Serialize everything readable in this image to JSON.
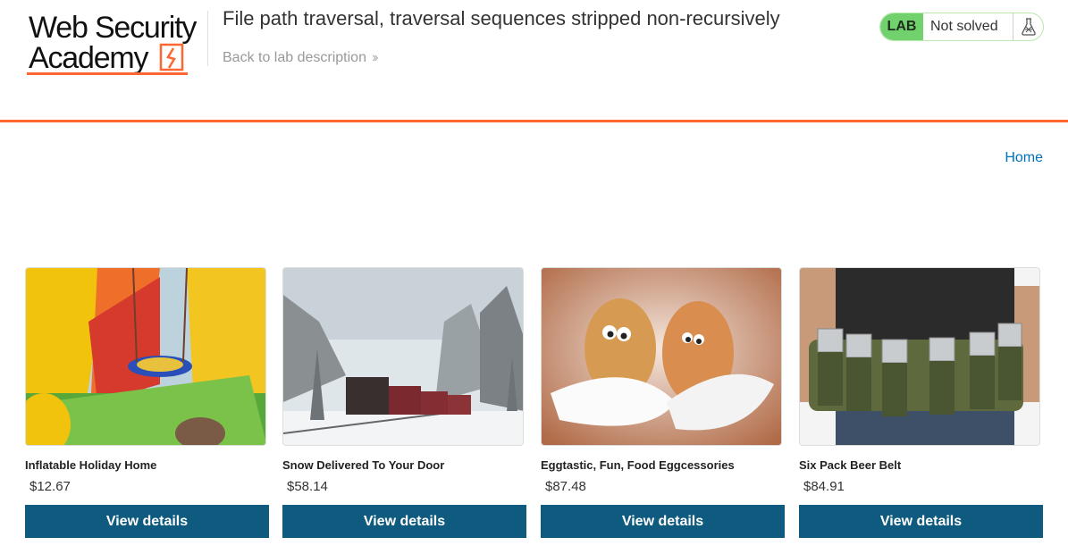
{
  "header": {
    "logo_line1": "Web Security",
    "logo_line2": "Academy",
    "lab_title": "File path traversal, traversal sequences stripped non-recursively",
    "back_link": "Back to lab description",
    "status_badge": "LAB",
    "status_text": "Not solved",
    "accent_color": "#ff6633",
    "solved_color": "#70d16d"
  },
  "nav": {
    "home": "Home"
  },
  "products": [
    {
      "name": "Inflatable Holiday Home",
      "price": "$12.67",
      "button": "View details"
    },
    {
      "name": "Snow Delivered To Your Door",
      "price": "$58.14",
      "button": "View details"
    },
    {
      "name": "Eggtastic, Fun, Food Eggcessories",
      "price": "$87.48",
      "button": "View details"
    },
    {
      "name": "Six Pack Beer Belt",
      "price": "$84.91",
      "button": "View details"
    }
  ],
  "colors": {
    "button": "#0f5b7f",
    "link": "#0071bc"
  }
}
